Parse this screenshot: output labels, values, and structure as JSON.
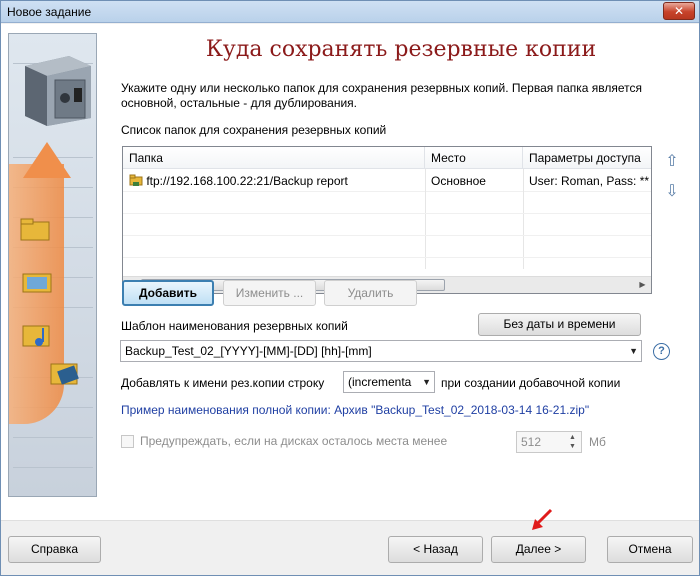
{
  "window": {
    "title": "Новое задание",
    "close_label": "✕"
  },
  "heading": "Куда сохранять резервные копии",
  "description": "Укажите одну или несколько папок для сохранения резервных копий. Первая папка является основной, остальные - для дублирования.",
  "folder_list": {
    "label": "Список папок для сохранения резервных копий",
    "columns": [
      "Папка",
      "Место",
      "Параметры доступа"
    ],
    "rows": [
      {
        "folder": "ftp://192.168.100.22:21/Backup report",
        "place": "Основное",
        "access": "User: Roman, Pass: **"
      }
    ]
  },
  "list_buttons": {
    "add": "Добавить",
    "edit": "Изменить ...",
    "delete": "Удалить"
  },
  "template": {
    "label": "Шаблон наименования резервных копий",
    "no_date_button": "Без даты и времени",
    "value": "Backup_Test_02_[YYYY]-[MM]-[DD] [hh]-[mm]",
    "help": "?"
  },
  "append": {
    "label": "Добавлять к имени рез.копии строку",
    "value": "(incrementa",
    "suffix": "при создании добавочной копии"
  },
  "example": "Пример наименования полной копии: Архив \"Backup_Test_02_2018-03-14 16-21.zip\"",
  "disk_warning": {
    "label": "Предупреждать, если на дисках осталось места менее",
    "value": "512",
    "unit": "Мб",
    "checked": false
  },
  "footer": {
    "help": "Справка",
    "back": "< Назад",
    "next": "Далее >",
    "cancel": "Отмена"
  },
  "colors": {
    "heading": "#8b1a1a",
    "example_link": "#1f3fa3",
    "primary_border": "#3c7fb1"
  }
}
